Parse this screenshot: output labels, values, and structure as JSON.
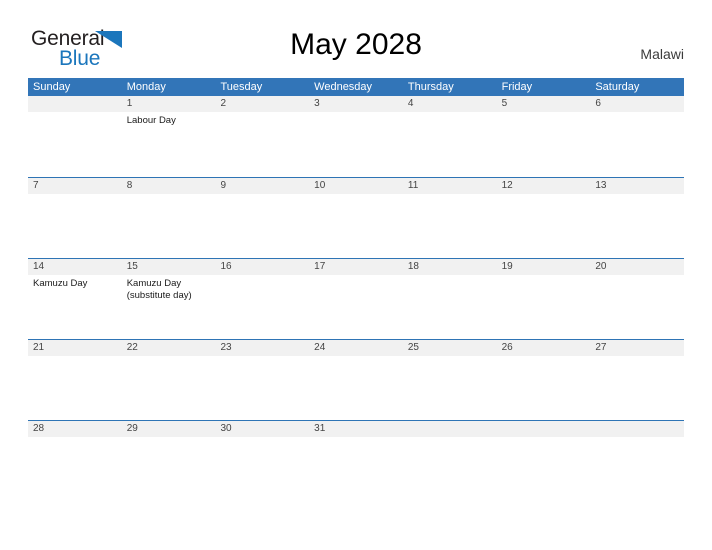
{
  "brand": {
    "name_part1": "General",
    "name_part2": "Blue",
    "flag_color": "#1b76bc",
    "text_color": "#231f20"
  },
  "header": {
    "title": "May 2028",
    "country": "Malawi"
  },
  "theme": {
    "header_blue": "#3275b8",
    "rule_blue": "#2e74b5",
    "daynum_band": "#f1f1f1",
    "page_background": "#ffffff"
  },
  "calendar": {
    "weekdays": [
      "Sunday",
      "Monday",
      "Tuesday",
      "Wednesday",
      "Thursday",
      "Friday",
      "Saturday"
    ],
    "weeks": [
      [
        {
          "date": "",
          "events": []
        },
        {
          "date": "1",
          "events": [
            "Labour Day"
          ]
        },
        {
          "date": "2",
          "events": []
        },
        {
          "date": "3",
          "events": []
        },
        {
          "date": "4",
          "events": []
        },
        {
          "date": "5",
          "events": []
        },
        {
          "date": "6",
          "events": []
        }
      ],
      [
        {
          "date": "7",
          "events": []
        },
        {
          "date": "8",
          "events": []
        },
        {
          "date": "9",
          "events": []
        },
        {
          "date": "10",
          "events": []
        },
        {
          "date": "11",
          "events": []
        },
        {
          "date": "12",
          "events": []
        },
        {
          "date": "13",
          "events": []
        }
      ],
      [
        {
          "date": "14",
          "events": [
            "Kamuzu Day"
          ]
        },
        {
          "date": "15",
          "events": [
            "Kamuzu Day (substitute day)"
          ]
        },
        {
          "date": "16",
          "events": []
        },
        {
          "date": "17",
          "events": []
        },
        {
          "date": "18",
          "events": []
        },
        {
          "date": "19",
          "events": []
        },
        {
          "date": "20",
          "events": []
        }
      ],
      [
        {
          "date": "21",
          "events": []
        },
        {
          "date": "22",
          "events": []
        },
        {
          "date": "23",
          "events": []
        },
        {
          "date": "24",
          "events": []
        },
        {
          "date": "25",
          "events": []
        },
        {
          "date": "26",
          "events": []
        },
        {
          "date": "27",
          "events": []
        }
      ],
      [
        {
          "date": "28",
          "events": []
        },
        {
          "date": "29",
          "events": []
        },
        {
          "date": "30",
          "events": []
        },
        {
          "date": "31",
          "events": []
        },
        {
          "date": "",
          "events": []
        },
        {
          "date": "",
          "events": []
        },
        {
          "date": "",
          "events": []
        }
      ]
    ]
  }
}
